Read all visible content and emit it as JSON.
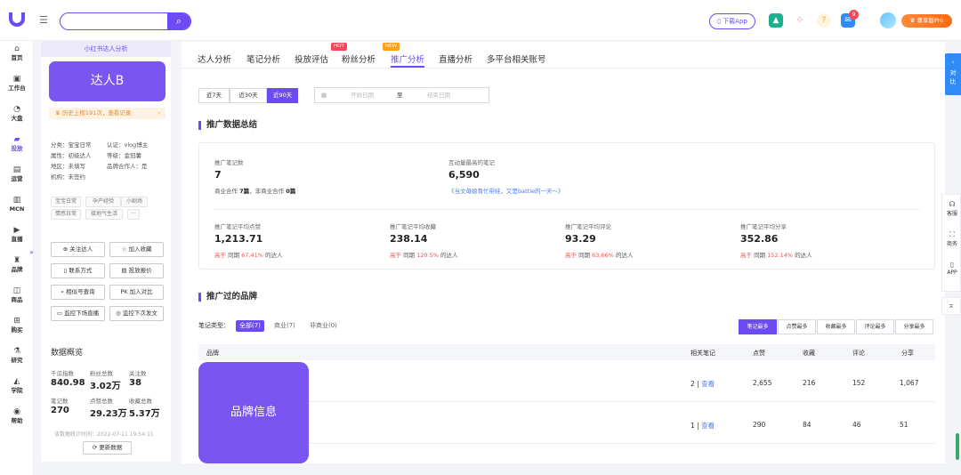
{
  "topbar": {
    "search_placeholder": "",
    "download_app": "下载App",
    "notification_count": "9",
    "pro_label": "尊享版Pro",
    "accent": "#6c4bf4"
  },
  "leftnav": [
    {
      "icon": "home-icon",
      "glyph": "⌂",
      "label": "首页"
    },
    {
      "icon": "workbench-icon",
      "glyph": "▣",
      "label": "工作台"
    },
    {
      "icon": "pie-icon",
      "glyph": "◔",
      "label": "大盘"
    },
    {
      "icon": "folder-icon",
      "glyph": "▰",
      "label": "投放"
    },
    {
      "icon": "notes-icon",
      "glyph": "▤",
      "label": "运营"
    },
    {
      "icon": "mcn-icon",
      "glyph": "▥",
      "label": "MCN"
    },
    {
      "icon": "live-icon",
      "glyph": "▶",
      "label": "直播"
    },
    {
      "icon": "brand-icon",
      "glyph": "♜",
      "label": "品牌"
    },
    {
      "icon": "product-icon",
      "glyph": "◫",
      "label": "商品"
    },
    {
      "icon": "cart-icon",
      "glyph": "⊞",
      "label": "购买"
    },
    {
      "icon": "research-icon",
      "glyph": "⚗",
      "label": "研究"
    },
    {
      "icon": "academy-icon",
      "glyph": "◭",
      "label": "学院"
    },
    {
      "icon": "help-icon",
      "glyph": "◉",
      "label": "帮助"
    }
  ],
  "profile": {
    "header": "小红书达人分析",
    "name": "达人B",
    "history": "历史上榜191次，查看记录",
    "info": {
      "category": "分类：宝宝日常",
      "attribute": "属性：初级达人",
      "region": "地区：未填写",
      "org": "机构：未签约",
      "cert": "认证：vlog博主",
      "level": "等级：金冠薯",
      "brand_coop": "品牌合作人：是"
    },
    "tags": [
      "宝宝日常",
      "孕产经验",
      "小剧场",
      "情感日常",
      "接地气生活",
      "···"
    ],
    "actions": [
      "关注达人",
      "加入收藏",
      "联系方式",
      "投放报价",
      "相似号查询",
      "加入对比",
      "监控下场直播",
      "监控下次发文"
    ],
    "overview": {
      "title": "数据概览",
      "items": [
        {
          "label": "千瓜指数",
          "value": "840.98"
        },
        {
          "label": "粉丝总数",
          "value": "3.02万"
        },
        {
          "label": "关注数",
          "value": "38"
        },
        {
          "label": "笔记数",
          "value": "270"
        },
        {
          "label": "点赞总数",
          "value": "29.23万"
        },
        {
          "label": "收藏总数",
          "value": "5.37万"
        }
      ],
      "updated": "该数据统计时间：2022-07-11 19:54:11",
      "update_btn": "更新数据"
    }
  },
  "tabs": [
    {
      "label": "达人分析"
    },
    {
      "label": "笔记分析"
    },
    {
      "label": "投放评估"
    },
    {
      "label": "粉丝分析",
      "pill": "HOT"
    },
    {
      "label": "推广分析",
      "pill": "NEW"
    },
    {
      "label": "直播分析"
    },
    {
      "label": "多平台相关账号"
    }
  ],
  "ranges": [
    "近7天",
    "近30天",
    "近90天"
  ],
  "date": {
    "start": "开始日期",
    "sep": "至",
    "end": "结束日期"
  },
  "summary": {
    "title": "推广数据总结",
    "count_label": "推广笔记数",
    "count_value": "7",
    "count_sub_prefix": "商业合作",
    "count_sub_biz": "7篇",
    "count_sub_mid": "，非商业合作",
    "count_sub_non": "0篇",
    "top_label": "互动量最高的笔记",
    "top_value": "6,590",
    "top_link": "《当文母娘育忙带娃，又是battle的一天～》",
    "metrics": [
      {
        "label": "推广笔记平均点赞",
        "value": "1,213.71",
        "pct": "67.41%"
      },
      {
        "label": "推广笔记平均收藏",
        "value": "238.14",
        "pct": "120.5%"
      },
      {
        "label": "推广笔记平均评论",
        "value": "93.29",
        "pct": "63.66%"
      },
      {
        "label": "推广笔记平均分享",
        "value": "352.86",
        "pct": "152.14%"
      }
    ],
    "compare_prefix": "高于",
    "compare_mid": "同期",
    "compare_suffix": "的达人"
  },
  "brands": {
    "title": "推广过的品牌",
    "filter_label": "笔记类型：",
    "filters": [
      "全部(7)",
      "商业(7)",
      "非商业(0)"
    ],
    "sorts": [
      "笔记最多",
      "点赞最多",
      "收藏最多",
      "评论最多",
      "分享最多"
    ],
    "columns": [
      "品牌",
      "相关笔记",
      "点赞",
      "收藏",
      "评论",
      "分享"
    ],
    "rows": [
      {
        "notes": "2",
        "view": "查看",
        "likes": "2,655",
        "favs": "216",
        "comments": "152",
        "shares": "1,067"
      },
      {
        "notes": "1",
        "view": "查看",
        "likes": "290",
        "favs": "84",
        "comments": "46",
        "shares": "51"
      }
    ],
    "overlay": "品牌信息"
  },
  "right": {
    "compare": "对比",
    "items": [
      {
        "icon": "headset-icon",
        "glyph": "☊",
        "label": "客服"
      },
      {
        "icon": "merchant-icon",
        "glyph": "⛶",
        "label": "商务"
      },
      {
        "icon": "phone-icon",
        "glyph": "▯",
        "label": "APP"
      }
    ]
  }
}
